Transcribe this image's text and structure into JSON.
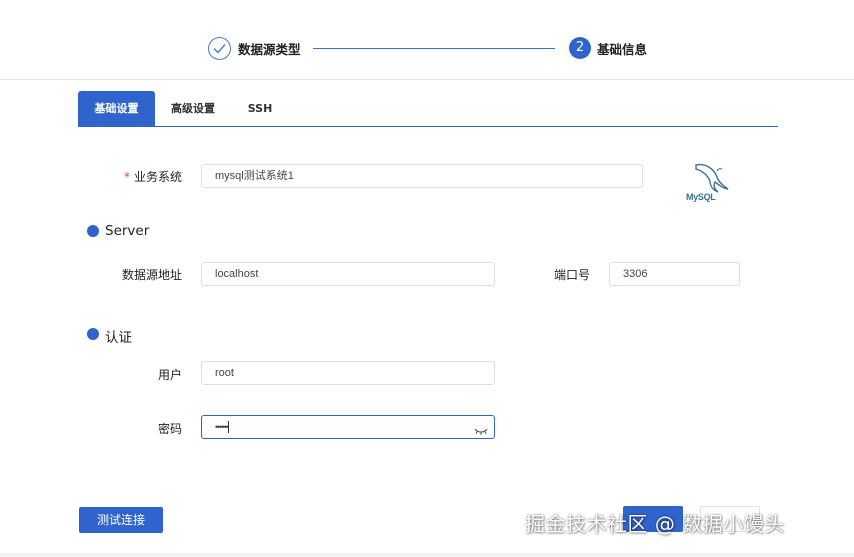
{
  "steps": [
    {
      "label": "数据源类型",
      "state": "done"
    },
    {
      "number": "2",
      "label": "基础信息",
      "state": "active"
    }
  ],
  "tabs": [
    "基础设置",
    "高级设置",
    "SSH"
  ],
  "form": {
    "business_label": "业务系统",
    "business_required": "*",
    "business_value": "mysql测试系统1",
    "server_section": "Server",
    "host_label": "数据源地址",
    "host_value": "localhost",
    "port_label": "端口号",
    "port_value": "3306",
    "auth_section": "认证",
    "user_label": "用户",
    "user_value": "root",
    "password_label": "密码",
    "password_value": "••••••"
  },
  "logo_text": "MySQL",
  "buttons": {
    "test_connection": "测试连接"
  },
  "watermark": "掘金技术社区 @ 数据小馒头",
  "icons": [
    "check-icon",
    "mysql-logo",
    "eye-closed-icon"
  ],
  "colors": {
    "accent": "#3064cc",
    "required": "#e0483b"
  }
}
